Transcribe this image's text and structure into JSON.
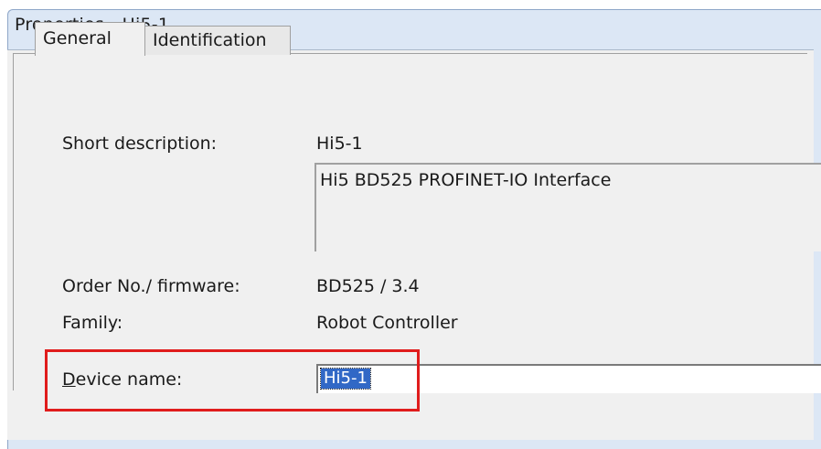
{
  "window": {
    "title": "Properties - Hi5-1"
  },
  "tabs": [
    {
      "label": "General",
      "active": true
    },
    {
      "label": "Identification",
      "active": false
    }
  ],
  "fields": {
    "short_description_label": "Short description:",
    "short_description_value": "Hi5-1",
    "description_text": "Hi5 BD525 PROFINET-IO Interface",
    "order_no_label": "Order No./ firmware:",
    "order_no_value": "BD525 / 3.4",
    "family_label": "Family:",
    "family_value": "Robot Controller",
    "device_name_label_prefix": "D",
    "device_name_label_rest": "evice name:",
    "device_name_value": "Hi5-1"
  },
  "colors": {
    "highlight": "#e01c1c",
    "selection": "#3168c6"
  }
}
